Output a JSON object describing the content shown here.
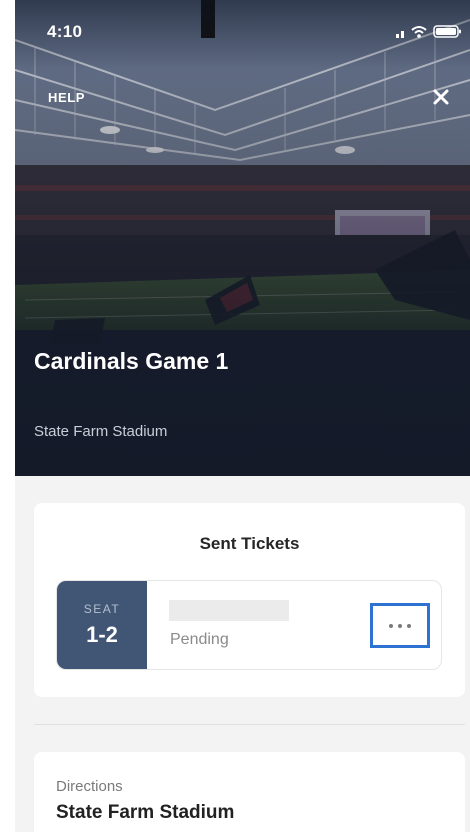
{
  "status_bar": {
    "time": "4:10"
  },
  "hero": {
    "help_label": "HELP",
    "close_icon": "close-icon",
    "event_title": "Cardinals Game 1",
    "venue": "State Farm Stadium"
  },
  "tickets": {
    "title": "Sent Tickets",
    "items": [
      {
        "seat_label": "SEAT",
        "seat": "1-2",
        "status": "Pending"
      }
    ],
    "more_icon": "more-horizontal-icon"
  },
  "directions": {
    "label": "Directions",
    "venue": "State Farm Stadium"
  },
  "colors": {
    "seat_box": "#415574",
    "focus_outline": "#2e72d2",
    "background": "#f3f3f4"
  }
}
